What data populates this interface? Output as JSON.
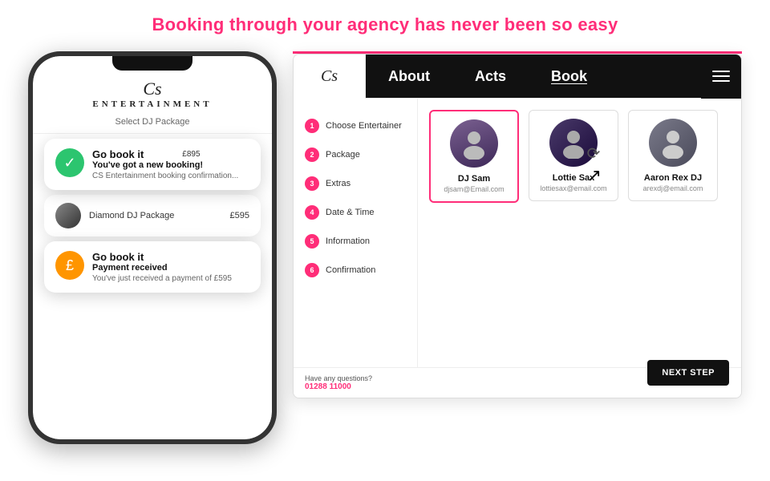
{
  "tagline": "Booking through your agency has never been so easy",
  "phone": {
    "logo_cs": "Cs",
    "logo_text": "ENTERTAINMENT",
    "select_label": "Select DJ Package",
    "notification1": {
      "title": "Go book it",
      "price": "£895",
      "subtitle": "You've got a new booking!",
      "body": "CS Entertainment booking confirmation..."
    },
    "dj_package_label": "Diamond DJ Package",
    "dj_package_price": "£595",
    "notification2": {
      "title": "Go book it",
      "subtitle": "Payment received",
      "body": "You've just received a payment of £595"
    }
  },
  "website": {
    "nav_logo": "Cs",
    "nav_about": "About",
    "nav_acts": "Acts",
    "nav_book": "Book",
    "steps": [
      {
        "number": "1",
        "label": "Choose Entertainer"
      },
      {
        "number": "2",
        "label": "Package"
      },
      {
        "number": "3",
        "label": "Extras"
      },
      {
        "number": "4",
        "label": "Date & Time"
      },
      {
        "number": "5",
        "label": "Information"
      },
      {
        "number": "6",
        "label": "Confirmation"
      }
    ],
    "acts": [
      {
        "name": "DJ Sam",
        "email": "djsam@Email.com",
        "selected": true
      },
      {
        "name": "Lottie Sax",
        "email": "lottiesax@email.com",
        "selected": false
      },
      {
        "name": "Aaron Rex DJ",
        "email": "arexdj@email.com",
        "selected": false
      }
    ],
    "footer_question": "Have any questions?",
    "footer_phone": "01288 11000",
    "next_step_label": "NEXT STEP"
  }
}
